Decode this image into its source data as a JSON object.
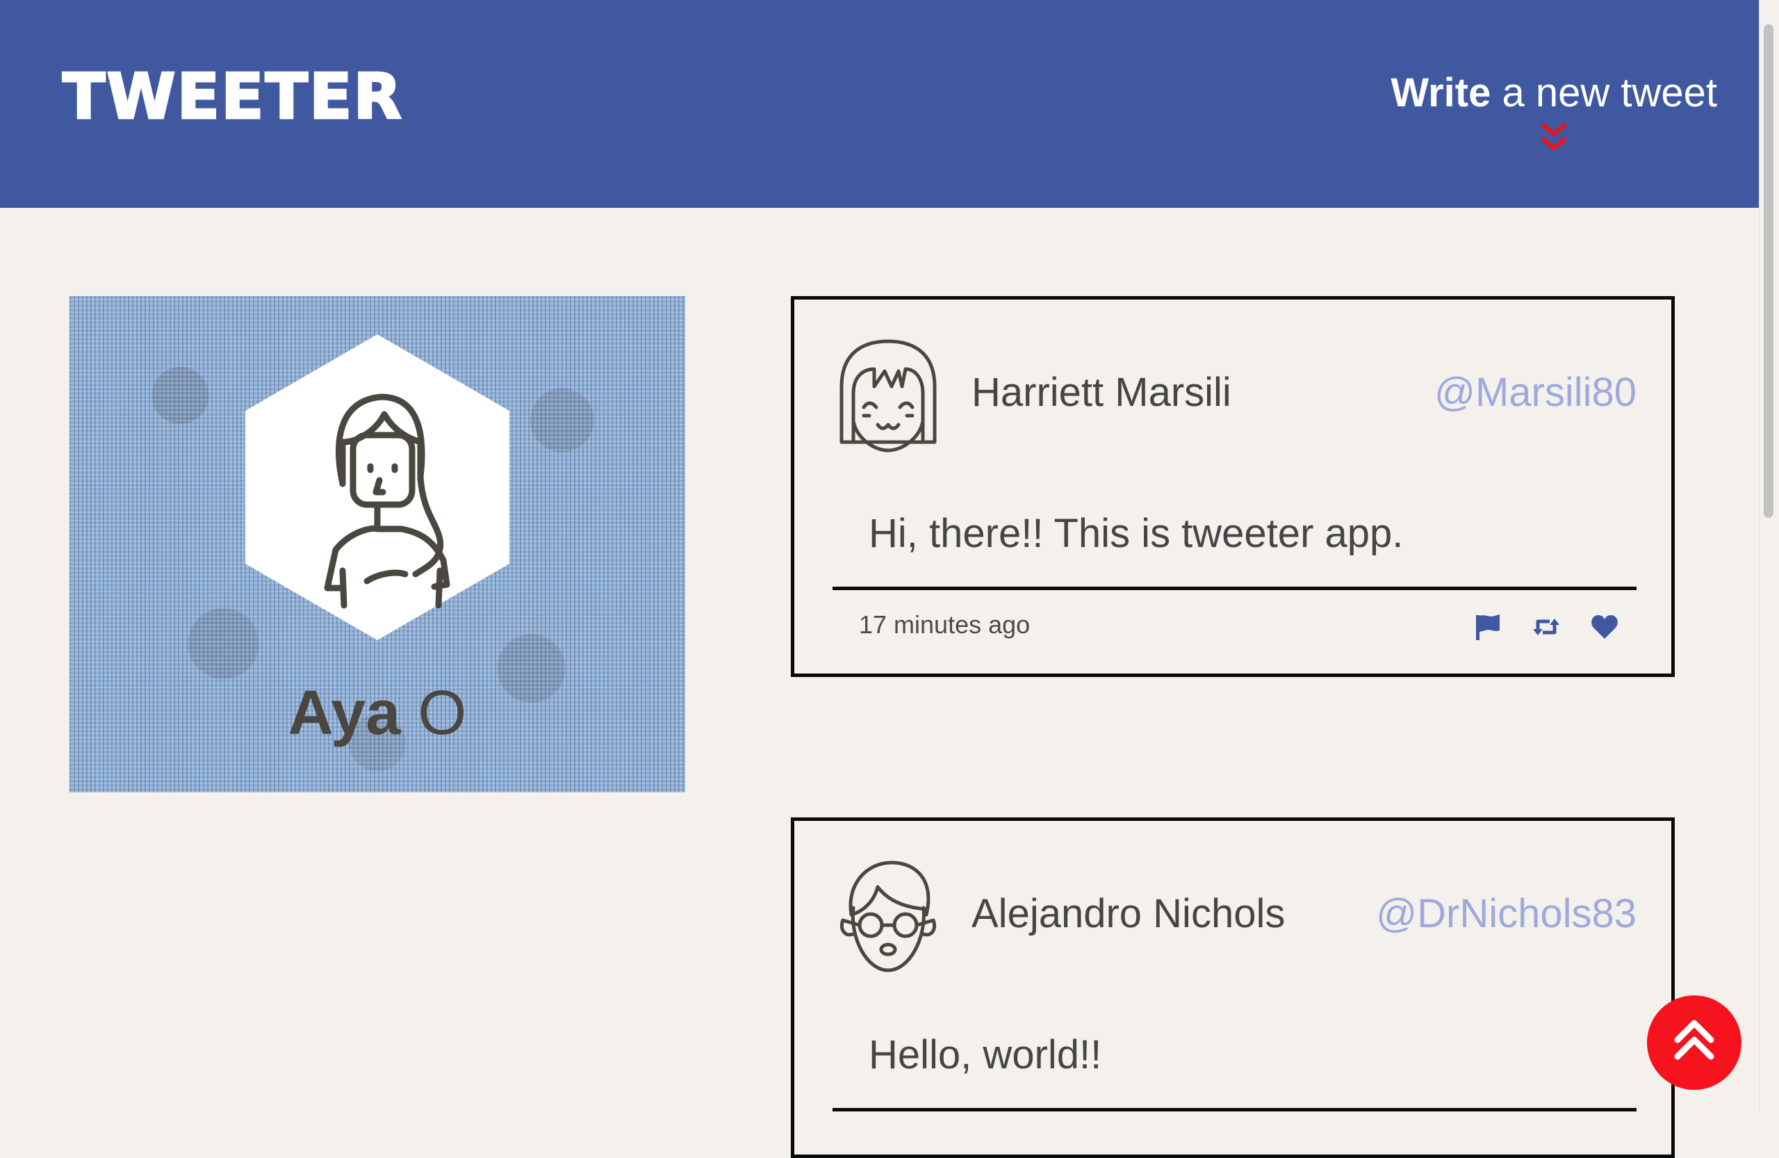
{
  "nav": {
    "logo": "TWEETER",
    "compose_strong": "Write",
    "compose_rest": " a new tweet",
    "compose_icon": "double-chevron-down-icon",
    "accent_color": "#e8141e",
    "background_color": "#4058a0"
  },
  "profile": {
    "first_name": "Aya",
    "last_name": "O",
    "avatar_icon": "female-avatar-icon"
  },
  "tweets": [
    {
      "name": "Harriett Marsili",
      "handle": "@Marsili80",
      "content": "Hi, there!! This is tweeter app.",
      "time": "17 minutes ago",
      "avatar_icon": "girl-avatar-icon",
      "actions": [
        "flag-icon",
        "retweet-icon",
        "heart-icon"
      ]
    },
    {
      "name": "Alejandro Nichols",
      "handle": "@DrNichols83",
      "content": "Hello, world!!",
      "avatar_icon": "man-glasses-avatar-icon"
    }
  ],
  "scroll_top": {
    "icon": "double-chevron-up-icon",
    "color": "#f5141e"
  }
}
